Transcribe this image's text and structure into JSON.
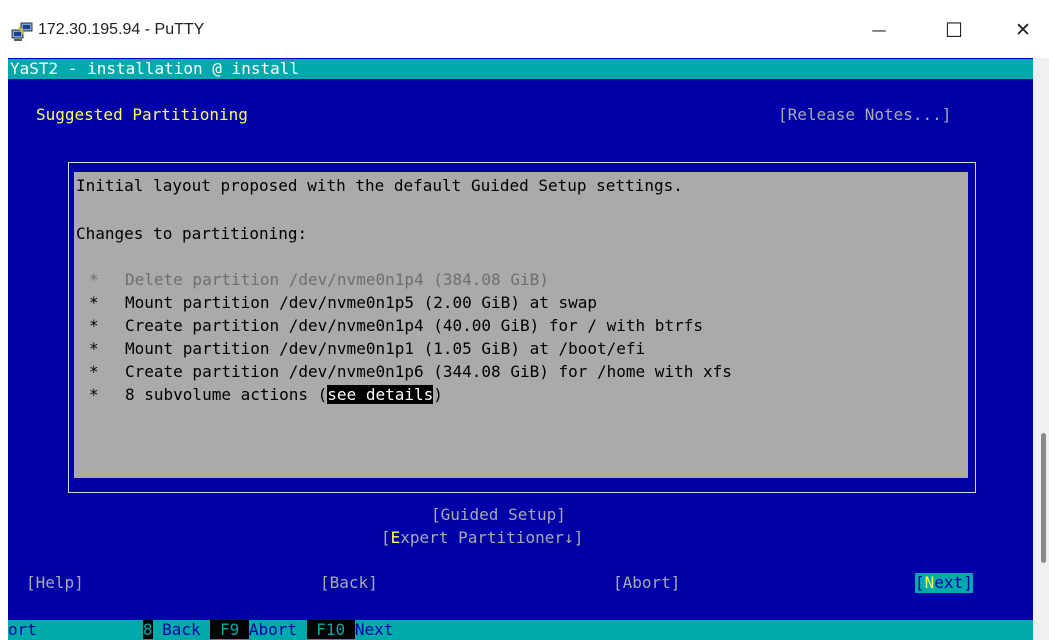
{
  "window": {
    "title": "172.30.195.94 - PuTTY",
    "minimize_symbol": "—",
    "maximize_symbol": "☐",
    "close_symbol": "✕"
  },
  "header_bar": {
    "text": "YaST2 - installation @ install"
  },
  "page": {
    "title": "Suggested Partitioning",
    "release_notes": "[Release Notes...]"
  },
  "dialog": {
    "intro": "Initial layout proposed with the default Guided Setup settings.",
    "changes_label": "Changes to partitioning:",
    "bullet": "*",
    "items": [
      {
        "text": "Delete partition /dev/nvme0n1p4 (384.08 GiB)",
        "dimmed": true
      },
      {
        "text": "Mount partition /dev/nvme0n1p5 (2.00 GiB) at swap"
      },
      {
        "text": "Create partition /dev/nvme0n1p4 (40.00 GiB) for / with btrfs"
      },
      {
        "text": "Mount partition /dev/nvme0n1p1 (1.05 GiB) at /boot/efi"
      },
      {
        "text": "Create partition /dev/nvme0n1p6 (344.08 GiB) for /home with xfs"
      }
    ],
    "subvolume_prefix": "8 subvolume actions (",
    "subvolume_link": "see details",
    "subvolume_suffix": ")"
  },
  "buttons": {
    "guided_setup_open": "[",
    "guided_setup_label": "Guided Setup",
    "guided_setup_close": "]",
    "expert_open": "[",
    "expert_hotkey": "E",
    "expert_rest": "xpert Partitioner",
    "expert_arrow": "↓",
    "expert_close": "]",
    "help": "[Help]",
    "back": "[Back]",
    "abort": "[Abort]",
    "next_open": "[",
    "next_hotkey": "N",
    "next_rest": "ext",
    "next_close": "]"
  },
  "function_bar": {
    "partial": "ort",
    "f8_key": "8",
    "f8_label": " Back ",
    "f9_key": " F9 ",
    "f9_label": "Abort ",
    "f10_key": " F10 ",
    "f10_label": "Next"
  },
  "colors": {
    "terminal_bg": "#0000a8",
    "cyan": "#00aaaa",
    "dialog_bg": "#aaaaaa",
    "hotkey": "#ffff55"
  }
}
